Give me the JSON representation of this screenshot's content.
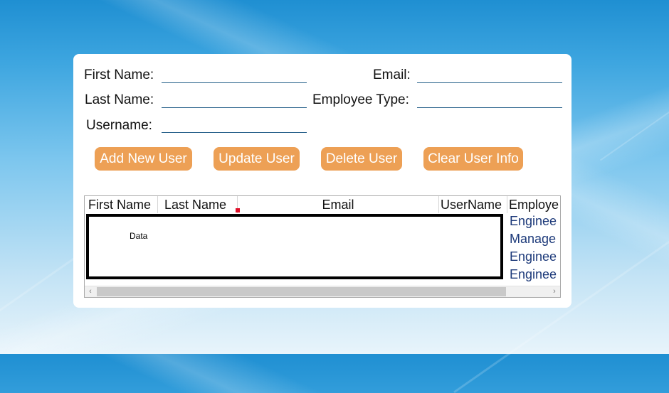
{
  "form": {
    "first_name_label": "First Name:",
    "last_name_label": "Last Name:",
    "username_label": "Username:",
    "email_label": "Email:",
    "employee_type_label": "Employee Type:",
    "first_name_value": "",
    "last_name_value": "",
    "username_value": "",
    "email_value": "",
    "employee_type_value": ""
  },
  "buttons": {
    "add": "Add New User",
    "update": "Update User",
    "delete": "Delete User",
    "clear": "Clear User Info"
  },
  "grid": {
    "columns": [
      "First Name",
      "Last Name",
      "Email",
      "UserName",
      "Employe"
    ],
    "data_label": "Data",
    "employee_types": [
      "Enginee",
      "Manage",
      "Enginee",
      "Enginee"
    ]
  },
  "colors": {
    "button_bg": "#eda055",
    "button_text": "#ffffff",
    "field_underline": "#1f5b86",
    "employee_type_text": "#1d3a7a",
    "marker": "#e0102a"
  },
  "icons": {
    "scroll_left": "chevron-left-icon",
    "scroll_right": "chevron-right-icon"
  }
}
